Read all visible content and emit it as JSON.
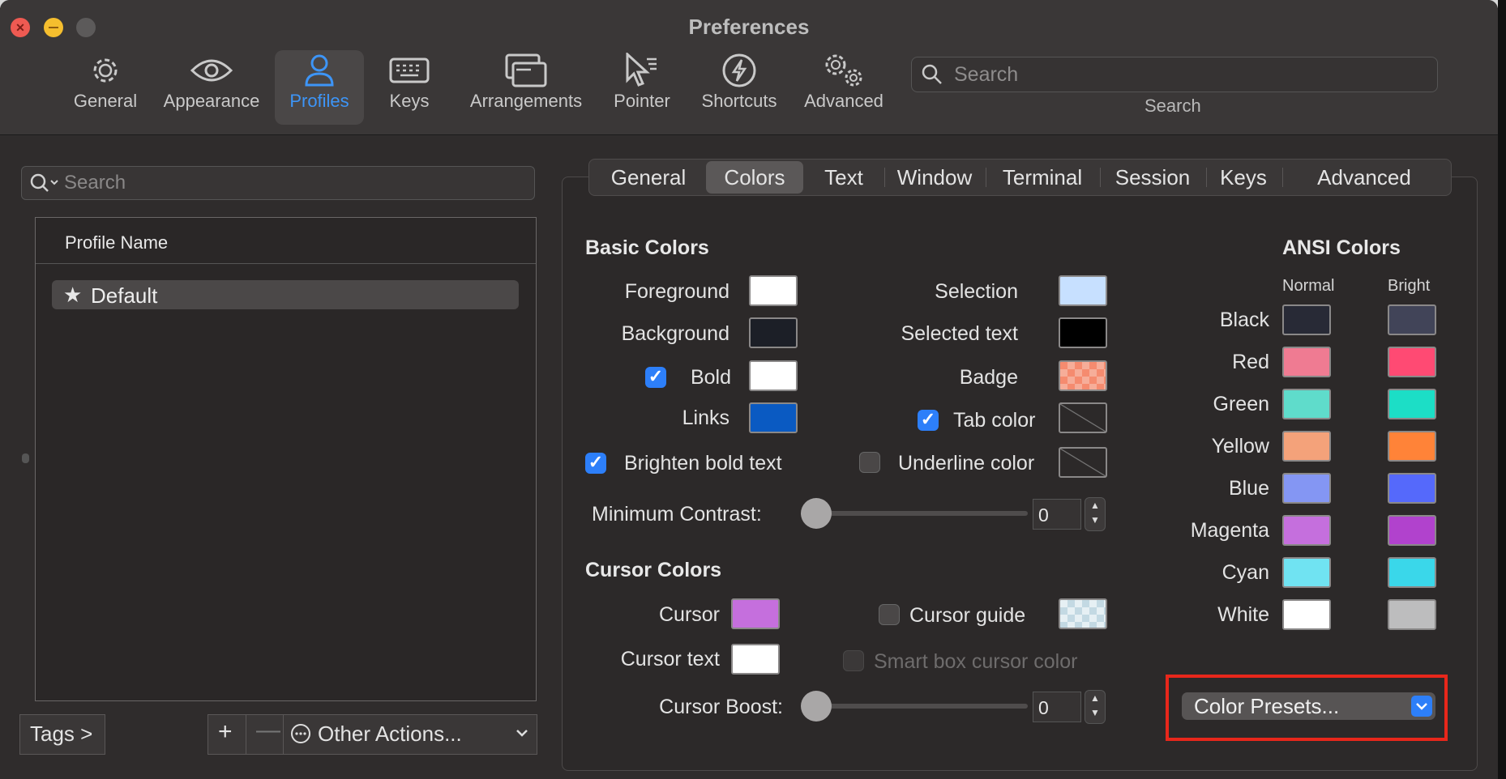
{
  "window": {
    "title": "Preferences"
  },
  "toolbar": {
    "items": [
      {
        "label": "General",
        "icon": "gear-icon"
      },
      {
        "label": "Appearance",
        "icon": "eye-icon"
      },
      {
        "label": "Profiles",
        "icon": "person-icon"
      },
      {
        "label": "Keys",
        "icon": "keyboard-icon"
      },
      {
        "label": "Arrangements",
        "icon": "windows-icon"
      },
      {
        "label": "Pointer",
        "icon": "pointer-icon"
      },
      {
        "label": "Shortcuts",
        "icon": "bolt-icon"
      },
      {
        "label": "Advanced",
        "icon": "gears-icon"
      }
    ],
    "active": "Profiles",
    "search_placeholder": "Search",
    "search_label": "Search"
  },
  "sidebar": {
    "search_placeholder": "Search",
    "column_header": "Profile Name",
    "profiles": [
      {
        "name": "Default",
        "default": true
      }
    ],
    "tags_button": "Tags >",
    "add_button": "+",
    "remove_button": "—",
    "other_actions": "Other Actions..."
  },
  "tabs": {
    "items": [
      "General",
      "Colors",
      "Text",
      "Window",
      "Terminal",
      "Session",
      "Keys",
      "Advanced"
    ],
    "active": "Colors"
  },
  "basic_colors": {
    "title": "Basic Colors",
    "foreground": {
      "label": "Foreground",
      "color": "#ffffff"
    },
    "background": {
      "label": "Background",
      "color": "#1c1f27"
    },
    "bold": {
      "label": "Bold",
      "color": "#ffffff",
      "checked": true
    },
    "links": {
      "label": "Links",
      "color": "#0a5ac2"
    },
    "selection": {
      "label": "Selection",
      "color": "#c7e0ff"
    },
    "selected_text": {
      "label": "Selected text",
      "color": "#000000"
    },
    "badge": {
      "label": "Badge",
      "color": "#f58b6f"
    },
    "tab_color": {
      "label": "Tab color",
      "checked": true
    },
    "brighten_bold": {
      "label": "Brighten bold text",
      "checked": true
    },
    "underline_color": {
      "label": "Underline color",
      "checked": false
    },
    "min_contrast": {
      "label": "Minimum Contrast:",
      "value": "0"
    }
  },
  "cursor_colors": {
    "title": "Cursor Colors",
    "cursor": {
      "label": "Cursor",
      "color": "#c56fdd"
    },
    "cursor_text": {
      "label": "Cursor text",
      "color": "#ffffff"
    },
    "cursor_guide": {
      "label": "Cursor guide",
      "checked": false
    },
    "smart_box": {
      "label": "Smart box cursor color",
      "checked": false
    },
    "cursor_boost": {
      "label": "Cursor Boost:",
      "value": "0"
    }
  },
  "ansi": {
    "title": "ANSI Colors",
    "normal_header": "Normal",
    "bright_header": "Bright",
    "rows": [
      {
        "name": "Black",
        "normal": "#282a36",
        "bright": "#414458"
      },
      {
        "name": "Red",
        "normal": "#ef7b92",
        "bright": "#ff4a73"
      },
      {
        "name": "Green",
        "normal": "#5fdccb",
        "bright": "#1cdec6"
      },
      {
        "name": "Yellow",
        "normal": "#f4a27a",
        "bright": "#ff8338"
      },
      {
        "name": "Blue",
        "normal": "#8496f3",
        "bright": "#5569fb"
      },
      {
        "name": "Magenta",
        "normal": "#c56fdd",
        "bright": "#b142cd"
      },
      {
        "name": "Cyan",
        "normal": "#70e3f2",
        "bright": "#3ad7ea"
      },
      {
        "name": "White",
        "normal": "#ffffff",
        "bright": "#bdbdbe"
      }
    ]
  },
  "color_presets": {
    "label": "Color Presets..."
  },
  "colors": {
    "accent": "#2d7ff9",
    "highlight_box": "#e8271b"
  }
}
